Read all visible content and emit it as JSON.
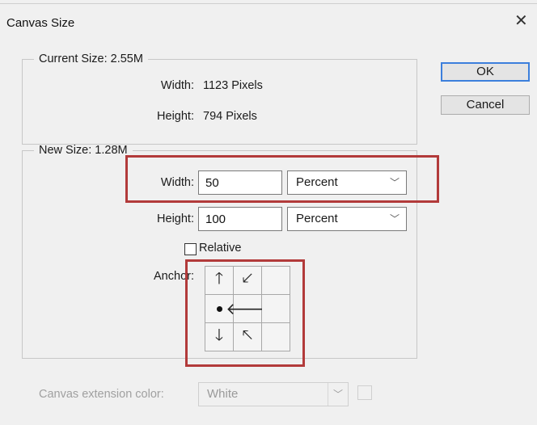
{
  "window": {
    "title": "Canvas Size",
    "close_glyph": "✕"
  },
  "buttons": {
    "ok": "OK",
    "cancel": "Cancel"
  },
  "current_size": {
    "legend": "Current Size: 2.55M",
    "width_label": "Width:",
    "width_value": "1123 Pixels",
    "height_label": "Height:",
    "height_value": "794 Pixels"
  },
  "new_size": {
    "legend": "New Size: 1.28M",
    "width_label": "Width:",
    "width_value": "50",
    "width_unit": "Percent",
    "height_label": "Height:",
    "height_value": "100",
    "height_unit": "Percent",
    "relative_label": "Relative",
    "relative_checked": false,
    "anchor_label": "Anchor:",
    "anchor_cells": [
      {
        "icon": "arrow-up-icon",
        "glyph": "🡑"
      },
      {
        "icon": "arrow-down-left-icon",
        "glyph": "🡗"
      },
      {
        "icon": "blank",
        "glyph": ""
      },
      {
        "icon": "anchor-center-dot-icon",
        "glyph": ""
      },
      {
        "icon": "arrow-left-icon",
        "glyph": "🡐"
      },
      {
        "icon": "blank",
        "glyph": ""
      },
      {
        "icon": "arrow-down-icon",
        "glyph": "🡓"
      },
      {
        "icon": "arrow-up-left-icon",
        "glyph": "🡔"
      },
      {
        "icon": "blank",
        "glyph": ""
      }
    ]
  },
  "extension": {
    "label": "Canvas extension color:",
    "value": "White"
  },
  "colors": {
    "highlight": "#b23a3a",
    "ok_border": "#3c7fdc"
  }
}
